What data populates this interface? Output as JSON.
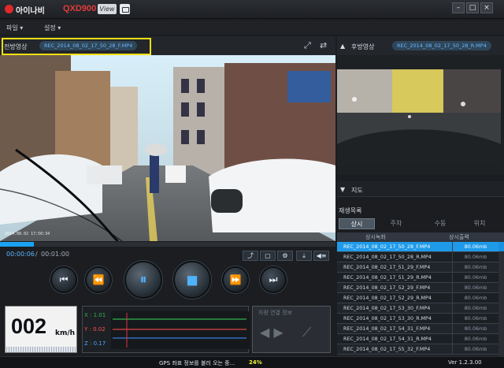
{
  "title_bar": {
    "logo": "아이나비",
    "model": "QXD900",
    "model_badge": "View"
  },
  "menu": {
    "file": "파일",
    "settings": "설정"
  },
  "front": {
    "label": "전방영상",
    "file": "REC_2014_08_02_17_50_28_F.MP4",
    "osd": "2014.08.02 17:50:34"
  },
  "rear": {
    "label": "후방영상",
    "file": "REC_2014_08_02_17_50_28_R.MP4"
  },
  "map": {
    "label": "지도"
  },
  "playlist": {
    "label": "재생목록",
    "tabs": [
      "상시",
      "주차",
      "수동",
      "위치"
    ],
    "active_tab": "상시",
    "columns": [
      "상시녹화",
      "상시출력"
    ],
    "rows": [
      {
        "name": "REC_2014_08_02_17_50_28_F.MP4",
        "size": "80.06mb",
        "selected": true
      },
      {
        "name": "REC_2014_08_02_17_50_28_R.MP4",
        "size": "80.06mb"
      },
      {
        "name": "REC_2014_08_02_17_51_29_F.MP4",
        "size": "80.06mb"
      },
      {
        "name": "REC_2014_08_02_17_51_29_R.MP4",
        "size": "80.06mb"
      },
      {
        "name": "REC_2014_08_02_17_52_29_F.MP4",
        "size": "80.06mb"
      },
      {
        "name": "REC_2014_08_02_17_52_29_R.MP4",
        "size": "80.06mb"
      },
      {
        "name": "REC_2014_08_02_17_53_30_F.MP4",
        "size": "80.06mb"
      },
      {
        "name": "REC_2014_08_02_17_53_30_R.MP4",
        "size": "80.06mb"
      },
      {
        "name": "REC_2014_08_02_17_54_31_F.MP4",
        "size": "80.06mb"
      },
      {
        "name": "REC_2014_08_02_17_54_31_R.MP4",
        "size": "80.06mb"
      },
      {
        "name": "REC_2014_08_02_17_55_32_F.MP4",
        "size": "80.06mb"
      }
    ]
  },
  "playback": {
    "current": "00:00:06",
    "separator": "/",
    "total": "00:01:00",
    "progress": 0.1
  },
  "speed": {
    "value": "002",
    "unit": "km/h"
  },
  "gsensor": {
    "x": "X : 1.01",
    "y": "Y : 0.02",
    "z": "Z : 0.17"
  },
  "connection": {
    "title": "차량 연결 정보"
  },
  "status": {
    "message": "GPS 좌표 정보를 불러 오는 중...",
    "percent": "24%",
    "version": "Ver 1.2.3.00"
  },
  "icons": {
    "minimize": "minimize-icon",
    "maximize": "maximize-icon",
    "close": "close-icon",
    "fullscreen": "expand-icon",
    "swap": "swap-icon",
    "prev": "skip-previous-icon",
    "rewind": "rewind-icon",
    "pause": "pause-icon",
    "stop": "stop-icon",
    "forward": "fast-forward-icon",
    "next": "skip-next-icon"
  },
  "colors": {
    "accent": "#1ba3f2",
    "highlight": "#f4e012",
    "brand": "#e02a2a"
  }
}
